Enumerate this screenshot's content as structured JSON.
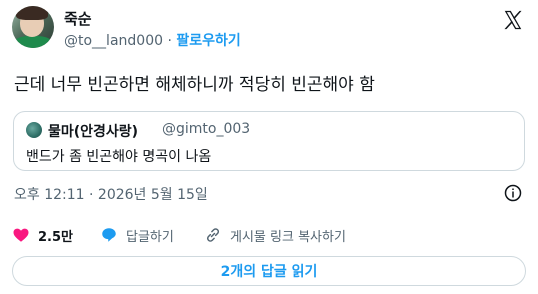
{
  "author": {
    "name": "죽순",
    "handle": "@to__land000",
    "separator": "·",
    "follow_label": "팔로우하기"
  },
  "tweet": {
    "text": "근데 너무 빈곤하면 해체하니까 적당히 빈곤해야 함"
  },
  "quote": {
    "name": "물마(안경사랑)",
    "handle": "@gimto_003",
    "text": "밴드가 좀 빈곤해야 명곡이 나옴"
  },
  "meta": {
    "timestamp": "오후 12:11 · 2026년 5월 15일"
  },
  "actions": {
    "like_count": "2.5만",
    "reply_label": "답글하기",
    "copy_link_label": "게시물 링크 복사하기"
  },
  "replies_button": {
    "label": "2개의 답글 읽기"
  },
  "colors": {
    "accent": "#1d9bf0",
    "like": "#f91880",
    "muted": "#536471"
  },
  "icons": [
    "x-logo-icon",
    "info-icon",
    "heart-icon",
    "reply-bubble-icon",
    "link-icon"
  ]
}
